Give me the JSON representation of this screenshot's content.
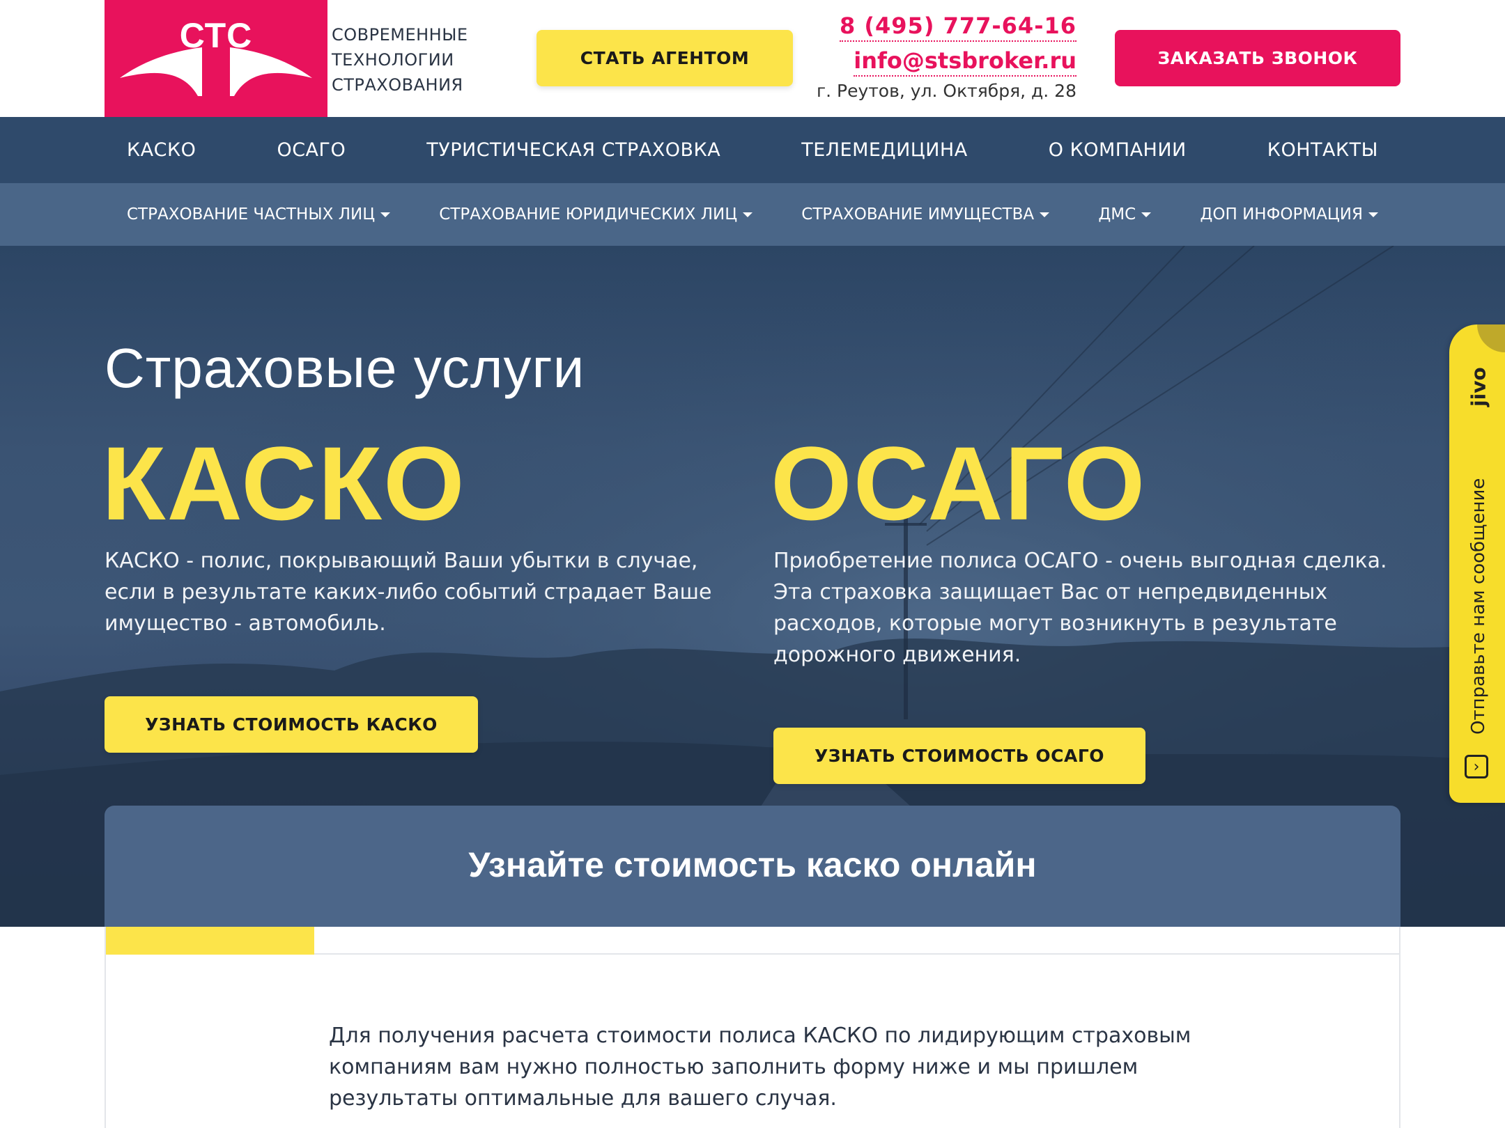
{
  "header": {
    "logo_text": "СТС",
    "tagline": [
      "СОВРЕМЕННЫЕ",
      "ТЕХНОЛОГИИ",
      "СТРАХОВАНИЯ"
    ],
    "agent_button": "СТАТЬ АГЕНТОМ",
    "phone": "8 (495) 777-64-16",
    "email": "info@stsbroker.ru",
    "address": "г. Реутов, ул. Октября, д. 28",
    "callback_button": "ЗАКАЗАТЬ ЗВОНОК"
  },
  "nav_main": [
    {
      "label": "КАСКО"
    },
    {
      "label": "ОСАГО"
    },
    {
      "label": "ТУРИСТИЧЕСКАЯ СТРАХОВКА"
    },
    {
      "label": "ТЕЛЕМЕДИЦИНА"
    },
    {
      "label": "О КОМПАНИИ"
    },
    {
      "label": "КОНТАКТЫ"
    }
  ],
  "nav_sub": [
    {
      "label": "СТРАХОВАНИЕ ЧАСТНЫХ ЛИЦ"
    },
    {
      "label": "СТРАХОВАНИЕ ЮРИДИЧЕСКИХ ЛИЦ"
    },
    {
      "label": "СТРАХОВАНИЕ ИМУЩЕСТВА"
    },
    {
      "label": "ДМС"
    },
    {
      "label": "ДОП ИНФОРМАЦИЯ"
    }
  ],
  "hero": {
    "title": "Страховые услуги",
    "kasko": {
      "heading": "КАСКО",
      "description": "КАСКО - полис, покрывающий Ваши убытки в случае, если в результате каких-либо событий страдает Ваше имущество - автомобиль.",
      "button": "УЗНАТЬ СТОИМОСТЬ КАСКО"
    },
    "osago": {
      "heading": "ОСАГО",
      "description": "Приобретение полиса ОСАГО - очень выгодная сделка. Эта страховка защищает Вас от непредвиденных расходов, которые могут возникнуть в результате дорожного движения.",
      "button": "УЗНАТЬ СТОИМОСТЬ ОСАГО"
    }
  },
  "calc": {
    "title": "Узнайте стоимость каско онлайн",
    "progress_fraction": 0.1613,
    "text": "Для получения расчета стоимости полиса КАСКО по лидирующим страховым компаниям вам нужно полностью заполнить форму ниже и мы пришлем результаты оптимальные для вашего случая."
  },
  "jivo": {
    "brand": "jivo",
    "text": "Отправьте нам сообщение",
    "icon": "chat-arrow-icon"
  },
  "colors": {
    "brand_pink": "#e8125c",
    "accent_yellow": "#fce44a",
    "nav_dark": "#2f4a6b",
    "nav_light": "#4a6688"
  }
}
